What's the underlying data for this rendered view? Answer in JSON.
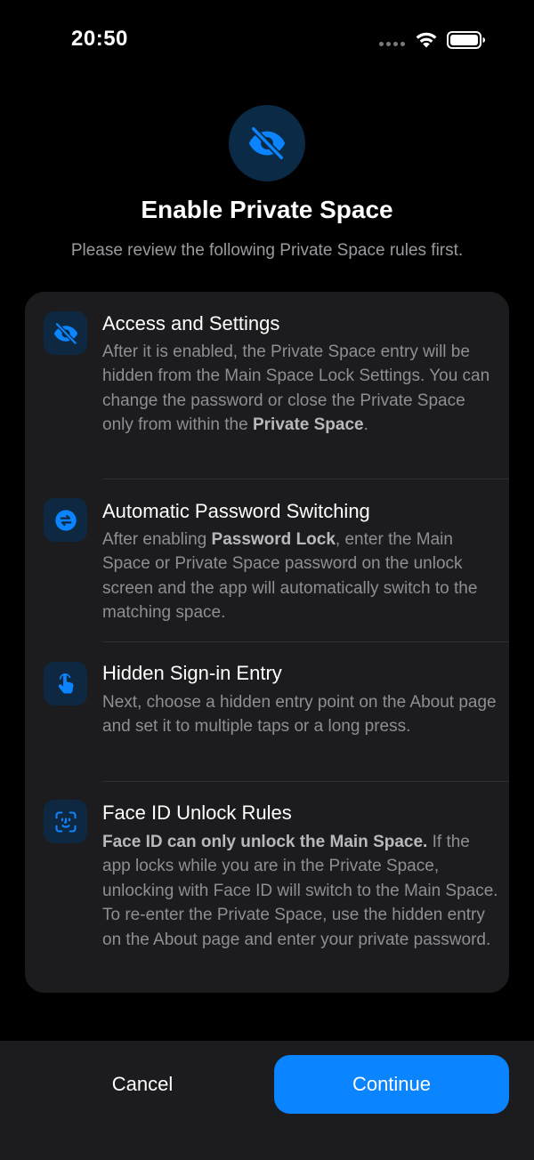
{
  "status_bar": {
    "time": "20:50"
  },
  "header": {
    "title": "Enable Private Space",
    "subtitle": "Please review the following Private Space rules first."
  },
  "rules": [
    {
      "icon": "eye-slash-icon",
      "title": "Access and Settings",
      "body_plain_1": "After it is enabled, the Private Space entry will be hidden from the Main Space Lock Settings. You can change the password or close the Private Space only from within the ",
      "body_bold_1": "Private Space",
      "body_plain_2": "."
    },
    {
      "icon": "switch-arrows-icon",
      "title": "Automatic Password Switching",
      "body_plain_1": "After enabling ",
      "body_bold_1": "Password Lock",
      "body_plain_2": ", enter the Main Space or Private Space password on the unlock screen and the app will automatically switch to the matching space."
    },
    {
      "icon": "hand-tap-icon",
      "title": "Hidden Sign-in Entry",
      "body_plain_1": "Next, choose a hidden entry point on the About page and set it to multiple taps or a long press."
    },
    {
      "icon": "face-id-icon",
      "title": "Face ID Unlock Rules",
      "body_bold_1": "Face ID can only unlock the Main Space.",
      "body_plain_1": " If the app locks while you are in the Private Space, unlocking with Face ID will switch to the Main Space. To re-enter the Private Space, use the hidden entry on the About page and enter your private password."
    }
  ],
  "actions": {
    "cancel_label": "Cancel",
    "continue_label": "Continue"
  },
  "colors": {
    "accent": "#0a84ff",
    "background": "#000000",
    "card": "#1c1c1e",
    "secondary_text": "#8e8e93"
  }
}
